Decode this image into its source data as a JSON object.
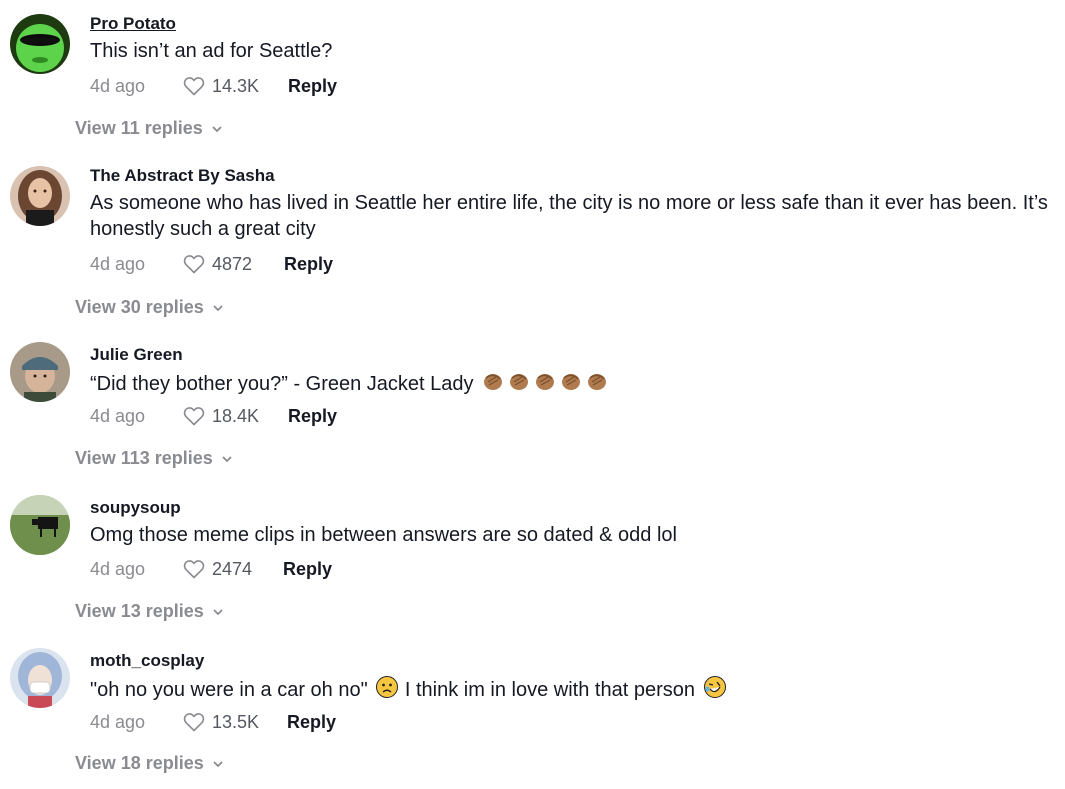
{
  "comments": [
    {
      "username": "Pro Potato",
      "text": "This isn’t an ad for Seattle?",
      "time": "4d ago",
      "likes": "14.3K",
      "reply": "Reply",
      "view": "View 11 replies",
      "avatar": "green-face-avatar"
    },
    {
      "username": "The Abstract By Sasha",
      "text": "As someone who has lived in Seattle her entire life, the city is no more or less safe than it ever has been. It’s honestly such a great city",
      "time": "4d ago",
      "likes": "4872",
      "reply": "Reply",
      "view": "View 30 replies",
      "avatar": "woman-portrait-avatar"
    },
    {
      "username": "Julie Green",
      "text": "“Did they bother you?” - Green Jacket Lady",
      "emoji": "clapping-hands-emoji",
      "emoji_count": 5,
      "time": "4d ago",
      "likes": "18.4K",
      "reply": "Reply",
      "view": "View 113 replies",
      "avatar": "cap-portrait-avatar"
    },
    {
      "username": "soupysoup",
      "text": "Omg those meme clips in between answers are so dated & odd lol",
      "time": "4d ago",
      "likes": "2474",
      "reply": "Reply",
      "view": "View 13 replies",
      "avatar": "cow-field-avatar"
    },
    {
      "username": "moth_cosplay",
      "text_a": "\"oh no you were in a car oh no\"",
      "text_b": "I think im in love with that person",
      "emoji_a": "worried-face-emoji",
      "emoji_b": "rolling-laughing-emoji",
      "time": "4d ago",
      "likes": "13.5K",
      "reply": "Reply",
      "view": "View 18 replies",
      "avatar": "masked-cosplay-avatar"
    }
  ],
  "colors": {
    "text": "#161823",
    "muted": "#8a8b91"
  }
}
